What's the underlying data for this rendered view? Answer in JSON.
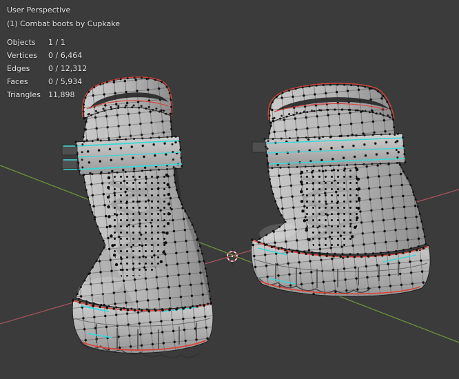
{
  "hud": {
    "perspective": "User Perspective",
    "collection": "(1) Combat boots by Cupkake",
    "stats": [
      {
        "label": "Objects",
        "value": "1 / 1"
      },
      {
        "label": "Vertices",
        "value": "0 / 6,464"
      },
      {
        "label": "Edges",
        "value": "0 / 12,312"
      },
      {
        "label": "Faces",
        "value": "0 / 5,934"
      },
      {
        "label": "Triangles",
        "value": "11,898"
      }
    ]
  },
  "colors": {
    "background": "#3b3b3b",
    "text": "#e3e3e3",
    "axis_y_green": "#76a13e",
    "axis_x_red": "#b95864",
    "edge_select_red": "#d8453a",
    "edge_mark_cyan": "#3bd6d8",
    "cursor_red": "#c13d3d",
    "mesh_gray": "#b4b4b4",
    "vertex_black": "#0d0d0d"
  }
}
